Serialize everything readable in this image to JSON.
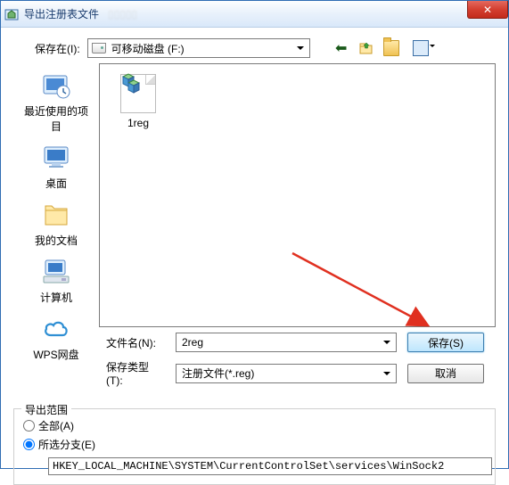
{
  "window": {
    "title": "导出注册表文件",
    "close": "✕"
  },
  "top": {
    "save_in_label": "保存在(I):",
    "location_text": "可移动磁盘 (F:)"
  },
  "sidebar": {
    "items": [
      {
        "label": "最近使用的项目"
      },
      {
        "label": "桌面"
      },
      {
        "label": "我的文档"
      },
      {
        "label": "计算机"
      },
      {
        "label": "WPS网盘"
      }
    ]
  },
  "files": [
    {
      "label": "1reg"
    }
  ],
  "fields": {
    "filename_label": "文件名(N):",
    "filename_value": "2reg",
    "filetype_label": "保存类型(T):",
    "filetype_value": "注册文件(*.reg)",
    "save_btn": "保存(S)",
    "cancel_btn": "取消"
  },
  "export": {
    "legend": "导出范围",
    "all_label": "全部(A)",
    "branch_label": "所选分支(E)",
    "branch_value": "HKEY_LOCAL_MACHINE\\SYSTEM\\CurrentControlSet\\services\\WinSock2"
  }
}
